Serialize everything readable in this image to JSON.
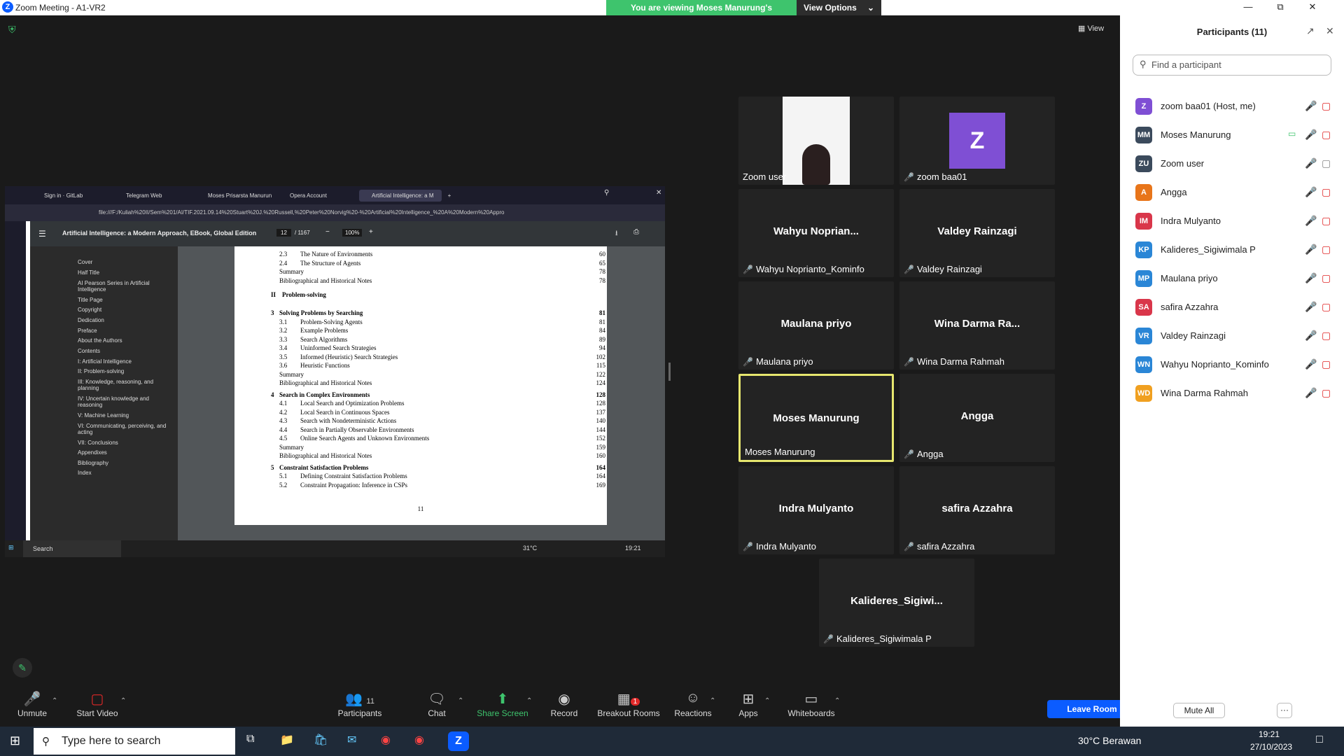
{
  "window": {
    "title": "Zoom Meeting - A1-VR2",
    "logo": "Z"
  },
  "banner": {
    "message": "You are viewing Moses Manurung's screen",
    "options_label": "View Options"
  },
  "view_label": "View",
  "shared": {
    "tabs": [
      "Sign in · GitLab",
      "Telegram Web",
      "Moses Prisarsta Manurun",
      "Opera Account",
      "Artificial Intelligence: a M"
    ],
    "address": "file:///F:/Kuliah%20II/Sem%201/AI/TIF.2021.09.14%20Stuart%20J.%20Russell,%20Peter%20Norvig%20-%20Artificial%20Intelligence_%20A%20Modern%20Appro",
    "pdf_title": "Artificial Intelligence: a Modern Approach, EBook, Global Edition",
    "page_current": "12",
    "page_total": "/ 1167",
    "zoom": "100%",
    "nav_items": [
      "Cover",
      "Half Title",
      "AI Pearson Series in Artificial Intelligence",
      "Title Page",
      "Copyright",
      "Dedication",
      "Preface",
      "About the Authors",
      "Contents",
      "I: Artificial Intelligence",
      "II: Problem-solving",
      "III: Knowledge, reasoning, and planning",
      "IV: Uncertain knowledge and reasoning",
      "V: Machine Learning",
      "VI: Communicating, perceiving, and acting",
      "VII: Conclusions",
      "Appendixes",
      "Bibliography",
      "Index"
    ],
    "toc": [
      {
        "num": "2.3",
        "title": "The Nature of Environments",
        "page": "60",
        "kind": "sec"
      },
      {
        "num": "2.4",
        "title": "The Structure of Agents",
        "page": "65",
        "kind": "sec"
      },
      {
        "num": "",
        "title": "Summary",
        "page": "78",
        "kind": "plain"
      },
      {
        "num": "",
        "title": "Bibliographical and Historical Notes",
        "page": "78",
        "kind": "plain"
      },
      {
        "num": "II",
        "title": "Problem-solving",
        "page": "",
        "kind": "part"
      },
      {
        "num": "3",
        "title": "Solving Problems by Searching",
        "page": "81",
        "kind": "chap"
      },
      {
        "num": "3.1",
        "title": "Problem-Solving Agents",
        "page": "81",
        "kind": "sec"
      },
      {
        "num": "3.2",
        "title": "Example Problems",
        "page": "84",
        "kind": "sec"
      },
      {
        "num": "3.3",
        "title": "Search Algorithms",
        "page": "89",
        "kind": "sec"
      },
      {
        "num": "3.4",
        "title": "Uninformed Search Strategies",
        "page": "94",
        "kind": "sec"
      },
      {
        "num": "3.5",
        "title": "Informed (Heuristic) Search Strategies",
        "page": "102",
        "kind": "sec"
      },
      {
        "num": "3.6",
        "title": "Heuristic Functions",
        "page": "115",
        "kind": "sec"
      },
      {
        "num": "",
        "title": "Summary",
        "page": "122",
        "kind": "plain"
      },
      {
        "num": "",
        "title": "Bibliographical and Historical Notes",
        "page": "124",
        "kind": "plain"
      },
      {
        "num": "4",
        "title": "Search in Complex Environments",
        "page": "128",
        "kind": "chap"
      },
      {
        "num": "4.1",
        "title": "Local Search and Optimization Problems",
        "page": "128",
        "kind": "sec"
      },
      {
        "num": "4.2",
        "title": "Local Search in Continuous Spaces",
        "page": "137",
        "kind": "sec"
      },
      {
        "num": "4.3",
        "title": "Search with Nondeterministic Actions",
        "page": "140",
        "kind": "sec"
      },
      {
        "num": "4.4",
        "title": "Search in Partially Observable Environments",
        "page": "144",
        "kind": "sec"
      },
      {
        "num": "4.5",
        "title": "Online Search Agents and Unknown Environments",
        "page": "152",
        "kind": "sec"
      },
      {
        "num": "",
        "title": "Summary",
        "page": "159",
        "kind": "plain"
      },
      {
        "num": "",
        "title": "Bibliographical and Historical Notes",
        "page": "160",
        "kind": "plain"
      },
      {
        "num": "5",
        "title": "Constraint Satisfaction Problems",
        "page": "164",
        "kind": "chap"
      },
      {
        "num": "5.1",
        "title": "Defining Constraint Satisfaction Problems",
        "page": "164",
        "kind": "sec"
      },
      {
        "num": "5.2",
        "title": "Constraint Propagation: Inference in CSPs",
        "page": "169",
        "kind": "sec"
      }
    ],
    "page_footer": "11",
    "taskbar_search": "Search",
    "taskbar_temp": "31°C",
    "taskbar_time": "19:21"
  },
  "tiles": [
    {
      "name": "",
      "label": "Zoom user",
      "muted": false,
      "video": "photo"
    },
    {
      "name": "Z",
      "label": "zoom baa01",
      "muted": true,
      "video": "avatar"
    },
    {
      "name": "Wahyu  Noprian...",
      "label": "Wahyu Noprianto_Kominfo",
      "muted": true
    },
    {
      "name": "Valdey Rainzagi",
      "label": "Valdey Rainzagi",
      "muted": true
    },
    {
      "name": "Maulana priyo",
      "label": "Maulana priyo",
      "muted": true
    },
    {
      "name": "Wina Darma Ra...",
      "label": "Wina Darma Rahmah",
      "muted": true
    },
    {
      "name": "Moses Manurung",
      "label": "Moses Manurung",
      "muted": false,
      "active": true
    },
    {
      "name": "Angga",
      "label": "Angga",
      "muted": true
    },
    {
      "name": "Indra Mulyanto",
      "label": "Indra Mulyanto",
      "muted": true
    },
    {
      "name": "safira Azzahra",
      "label": "safira Azzahra",
      "muted": true
    },
    {
      "name": "Kalideres_Sigiwi...",
      "label": "Kalideres_Sigiwimala P",
      "muted": true
    }
  ],
  "toolbar": {
    "unmute": "Unmute",
    "start_video": "Start Video",
    "participants": "Participants",
    "participants_count": "11",
    "chat": "Chat",
    "share": "Share Screen",
    "record": "Record",
    "breakout": "Breakout Rooms",
    "breakout_badge": "1",
    "reactions": "Reactions",
    "apps": "Apps",
    "whiteboards": "Whiteboards",
    "leave": "Leave Room"
  },
  "panel": {
    "title": "Participants (11)",
    "search_placeholder": "Find a participant",
    "mute_all": "Mute All",
    "more": "···",
    "participants": [
      {
        "initials": "Z",
        "name": "zoom baa01 (Host, me)",
        "color": "#7f4fd4",
        "mic": "off",
        "cam": "off"
      },
      {
        "initials": "MM",
        "name": "Moses Manurung",
        "color": "#3b4a5c",
        "mic": "on",
        "cam": "off",
        "sharing": true
      },
      {
        "initials": "ZU",
        "name": "Zoom user",
        "color": "#3b4a5c",
        "mic": "on",
        "cam": "on"
      },
      {
        "initials": "A",
        "name": "Angga",
        "color": "#e8751a",
        "mic": "off",
        "cam": "off"
      },
      {
        "initials": "IM",
        "name": "Indra Mulyanto",
        "color": "#d9364a",
        "mic": "off",
        "cam": "off"
      },
      {
        "initials": "KP",
        "name": "Kalideres_Sigiwimala P",
        "color": "#2a86d6",
        "mic": "off",
        "cam": "off"
      },
      {
        "initials": "MP",
        "name": "Maulana priyo",
        "color": "#2a86d6",
        "mic": "off",
        "cam": "off"
      },
      {
        "initials": "SA",
        "name": "safira Azzahra",
        "color": "#d9364a",
        "mic": "off",
        "cam": "off"
      },
      {
        "initials": "VR",
        "name": "Valdey Rainzagi",
        "color": "#2a86d6",
        "mic": "off",
        "cam": "off"
      },
      {
        "initials": "WN",
        "name": "Wahyu Noprianto_Kominfo",
        "color": "#2a86d6",
        "mic": "off",
        "cam": "off"
      },
      {
        "initials": "WD",
        "name": "Wina Darma Rahmah",
        "color": "#f0a020",
        "mic": "off",
        "cam": "off"
      }
    ]
  },
  "taskbar": {
    "search": "Type here to search",
    "weather": "30°C  Berawan",
    "time": "19:21",
    "date": "27/10/2023"
  }
}
